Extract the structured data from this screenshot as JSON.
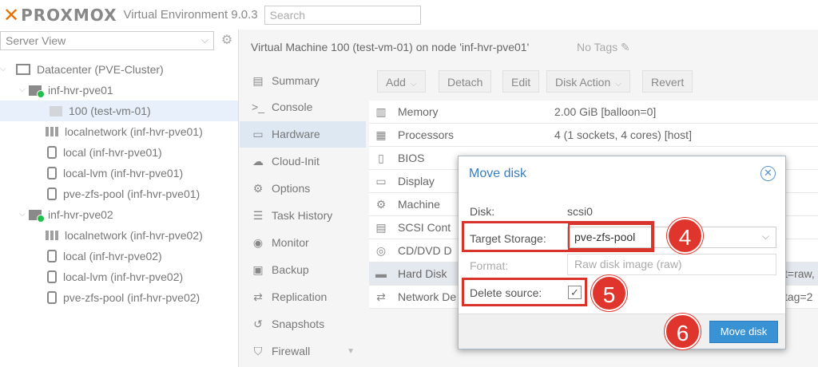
{
  "app": {
    "logo_text": "PROXMOX",
    "title": "Virtual Environment 9.0.3",
    "search_placeholder": "Search"
  },
  "sidebar": {
    "view": "Server View",
    "tree": [
      {
        "label": "Datacenter (PVE-Cluster)",
        "icon": "datacenter-icon"
      },
      {
        "label": "inf-hvr-pve01",
        "icon": "node-online-icon"
      },
      {
        "label": "100 (test-vm-01)",
        "icon": "vm-icon"
      },
      {
        "label": "localnetwork (inf-hvr-pve01)",
        "icon": "network-icon"
      },
      {
        "label": "local (inf-hvr-pve01)",
        "icon": "storage-icon"
      },
      {
        "label": "local-lvm (inf-hvr-pve01)",
        "icon": "storage-icon"
      },
      {
        "label": "pve-zfs-pool (inf-hvr-pve01)",
        "icon": "storage-icon"
      },
      {
        "label": "inf-hvr-pve02",
        "icon": "node-online-icon"
      },
      {
        "label": "localnetwork (inf-hvr-pve02)",
        "icon": "network-icon"
      },
      {
        "label": "local (inf-hvr-pve02)",
        "icon": "storage-icon"
      },
      {
        "label": "local-lvm (inf-hvr-pve02)",
        "icon": "storage-icon"
      },
      {
        "label": "pve-zfs-pool (inf-hvr-pve02)",
        "icon": "storage-icon"
      }
    ]
  },
  "content": {
    "title": "Virtual Machine 100 (test-vm-01) on node 'inf-hvr-pve01'",
    "tags": "No Tags",
    "menu": [
      "Summary",
      "Console",
      "Hardware",
      "Cloud-Init",
      "Options",
      "Task History",
      "Monitor",
      "Backup",
      "Replication",
      "Snapshots",
      "Firewall"
    ],
    "toolbar": {
      "add": "Add",
      "detach": "Detach",
      "edit": "Edit",
      "disk_action": "Disk Action",
      "revert": "Revert"
    },
    "hardware": [
      {
        "key": "Memory",
        "value": "2.00 GiB [balloon=0]"
      },
      {
        "key": "Processors",
        "value": "4 (1 sockets, 4 cores) [host]"
      },
      {
        "key": "BIOS",
        "value": ""
      },
      {
        "key": "Display",
        "value": ""
      },
      {
        "key": "Machine",
        "value": ""
      },
      {
        "key": "SCSI Cont",
        "value": ""
      },
      {
        "key": "CD/DVD D",
        "value": ""
      },
      {
        "key": "Hard Disk",
        "value": "t=raw,"
      },
      {
        "key": "Network De",
        "value": "tag=2"
      }
    ]
  },
  "dialog": {
    "title": "Move disk",
    "disk_label": "Disk:",
    "disk_value": "scsi0",
    "target_label": "Target Storage:",
    "target_value": "pve-zfs-pool",
    "format_label": "Format:",
    "format_value": "Raw disk image (raw)",
    "delete_label": "Delete source:",
    "button": "Move disk"
  },
  "annotations": {
    "step4": "4",
    "step5": "5",
    "step6": "6",
    "color": "#e0352c"
  }
}
